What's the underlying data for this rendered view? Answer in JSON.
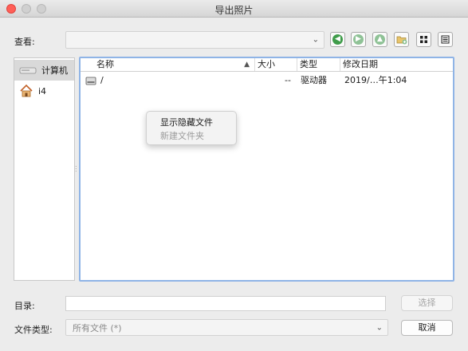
{
  "window": {
    "title": "导出照片"
  },
  "lookin": {
    "label": "查看:",
    "value": ""
  },
  "toolbar": {
    "back_icon": "back-arrow-icon",
    "forward_icon": "forward-arrow-icon",
    "up_icon": "up-arrow-icon",
    "newfolder_icon": "new-folder-icon",
    "listview_icon": "list-view-icon",
    "detailview_icon": "detail-view-icon"
  },
  "sidebar": {
    "items": [
      {
        "label": "计算机",
        "icon": "drive-icon",
        "selected": true
      },
      {
        "label": "i4",
        "icon": "home-icon",
        "selected": false
      }
    ]
  },
  "filelist": {
    "columns": [
      "名称",
      "大小",
      "类型",
      "修改日期"
    ],
    "sort_indicator": "▲",
    "rows": [
      {
        "name": "/",
        "size": "--",
        "type": "驱动器",
        "date": "2019/…午1:04"
      }
    ]
  },
  "context_menu": {
    "items": [
      {
        "label": "显示隐藏文件",
        "enabled": true
      },
      {
        "label": "新建文件夹",
        "enabled": false
      }
    ]
  },
  "directory": {
    "label": "目录:",
    "value": ""
  },
  "filetype": {
    "label": "文件类型:",
    "value": "所有文件 (*)"
  },
  "buttons": {
    "choose": "选择",
    "cancel": "取消"
  },
  "colors": {
    "accent_border": "#8fb4e6",
    "nav_green": "#3f9c4a",
    "nav_gray": "#8fc296"
  }
}
